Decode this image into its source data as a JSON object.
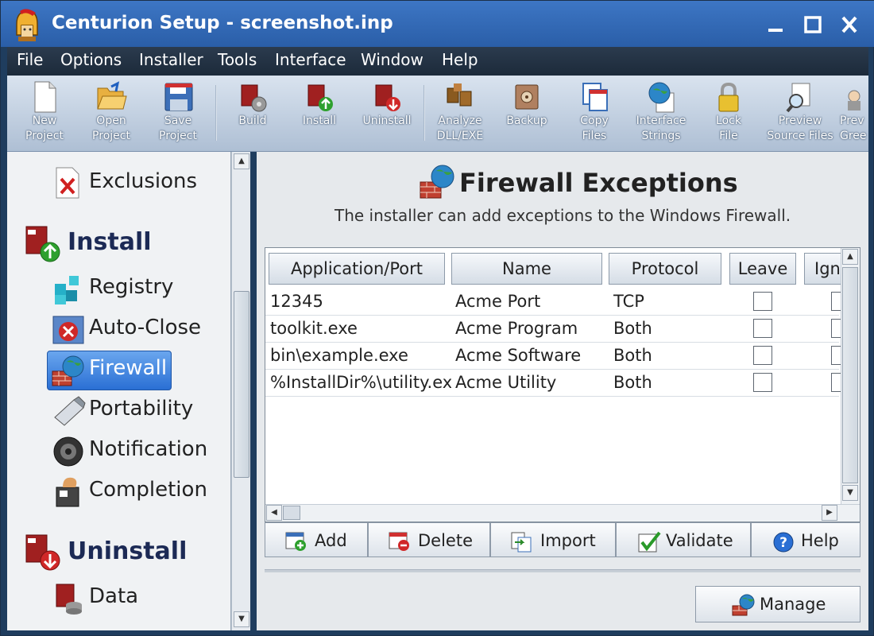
{
  "window": {
    "title": "Centurion Setup - screenshot.inp"
  },
  "menu": [
    "File",
    "Options",
    "Installer",
    "Tools",
    "Interface",
    "Window",
    "Help"
  ],
  "toolbar": [
    {
      "label1": "New",
      "label2": "Project",
      "icon": "new-project-icon"
    },
    {
      "label1": "Open",
      "label2": "Project",
      "icon": "open-folder-icon"
    },
    {
      "label1": "Save",
      "label2": "Project",
      "icon": "save-disk-icon"
    },
    {
      "label1": "Build",
      "label2": "",
      "icon": "build-icon"
    },
    {
      "label1": "Install",
      "label2": "",
      "icon": "install-icon"
    },
    {
      "label1": "Uninstall",
      "label2": "",
      "icon": "uninstall-icon"
    },
    {
      "label1": "Analyze",
      "label2": "DLL/EXE",
      "icon": "analyze-icon"
    },
    {
      "label1": "Backup",
      "label2": "",
      "icon": "backup-safe-icon"
    },
    {
      "label1": "Copy",
      "label2": "Files",
      "icon": "copy-files-icon"
    },
    {
      "label1": "Interface",
      "label2": "Strings",
      "icon": "globe-document-icon"
    },
    {
      "label1": "Lock",
      "label2": "File",
      "icon": "padlock-icon"
    },
    {
      "label1": "Preview",
      "label2": "Source Files",
      "icon": "preview-magnifier-icon"
    },
    {
      "label1": "Prev",
      "label2": "Gree",
      "icon": "preview-greeting-icon"
    }
  ],
  "sidebar": {
    "exclusions": "Exclusions",
    "install_heading": "Install",
    "registry": "Registry",
    "autoclose": "Auto-Close",
    "firewall": "Firewall",
    "portability": "Portability",
    "notification": "Notification",
    "completion": "Completion",
    "uninstall_heading": "Uninstall",
    "data": "Data"
  },
  "page": {
    "title": "Firewall Exceptions",
    "subtitle": "The installer can add exceptions to the Windows Firewall."
  },
  "grid": {
    "columns": [
      "Application/Port",
      "Name",
      "Protocol",
      "Leave",
      "Ign"
    ],
    "rows": [
      {
        "app": "12345",
        "name": "Acme Port",
        "protocol": "TCP",
        "leave": false,
        "ignore": false
      },
      {
        "app": "toolkit.exe",
        "name": "Acme Program",
        "protocol": "Both",
        "leave": false,
        "ignore": false
      },
      {
        "app": "bin\\example.exe",
        "name": "Acme Software",
        "protocol": "Both",
        "leave": false,
        "ignore": false
      },
      {
        "app": "%InstallDir%\\utility.exe",
        "name": "Acme Utility",
        "protocol": "Both",
        "leave": false,
        "ignore": false
      }
    ]
  },
  "buttons": {
    "add": "Add",
    "delete": "Delete",
    "import": "Import",
    "validate": "Validate",
    "help": "Help",
    "manage": "Manage"
  }
}
